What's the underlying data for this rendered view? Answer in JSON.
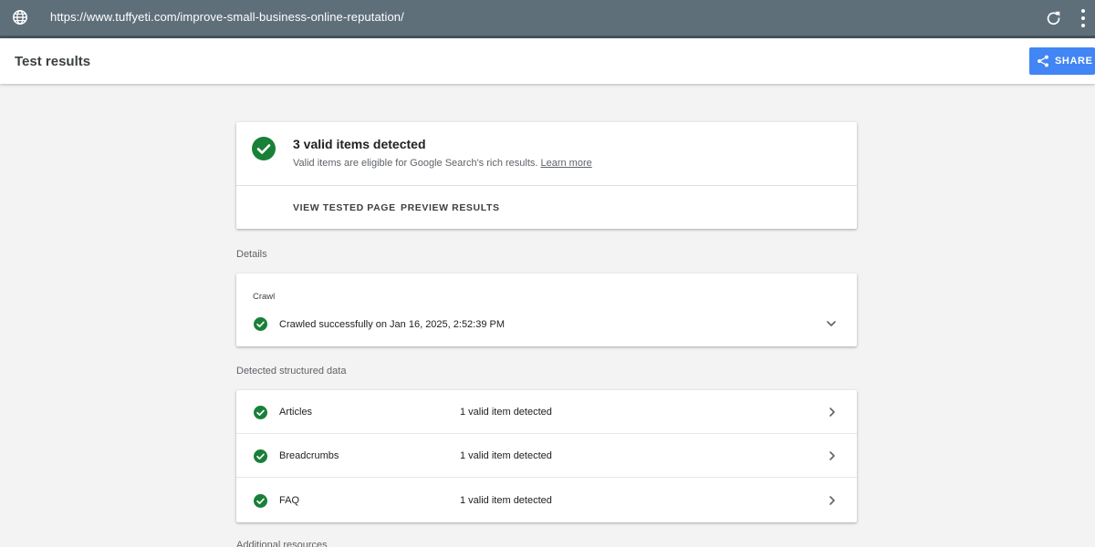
{
  "browser": {
    "url": "https://www.tuffyeti.com/improve-small-business-online-reputation/",
    "globe_icon": "globe-icon",
    "reload_icon": "reload-icon",
    "menu_icon": "more-vert-icon"
  },
  "header": {
    "title": "Test results",
    "share_label": "SHARE",
    "share_icon": "share-icon"
  },
  "summary": {
    "headline": "3 valid items detected",
    "description": "Valid items are eligible for Google Search's rich results.",
    "learn_more": "Learn more",
    "actions": [
      "VIEW TESTED PAGE",
      "PREVIEW RESULTS"
    ]
  },
  "details": {
    "section_label": "Details",
    "crawl_label": "Crawl",
    "crawl_status": "Crawled successfully on Jan 16, 2025, 2:52:39 PM"
  },
  "structured_data": {
    "section_label": "Detected structured data",
    "items": [
      {
        "name": "Articles",
        "status": "1 valid item detected"
      },
      {
        "name": "Breadcrumbs",
        "status": "1 valid item detected"
      },
      {
        "name": "FAQ",
        "status": "1 valid item detected"
      }
    ]
  },
  "footer_section_label": "Additional resources",
  "colors": {
    "success_green": "#188038",
    "share_blue": "#4285f4",
    "url_bar": "#5f6f7a"
  }
}
